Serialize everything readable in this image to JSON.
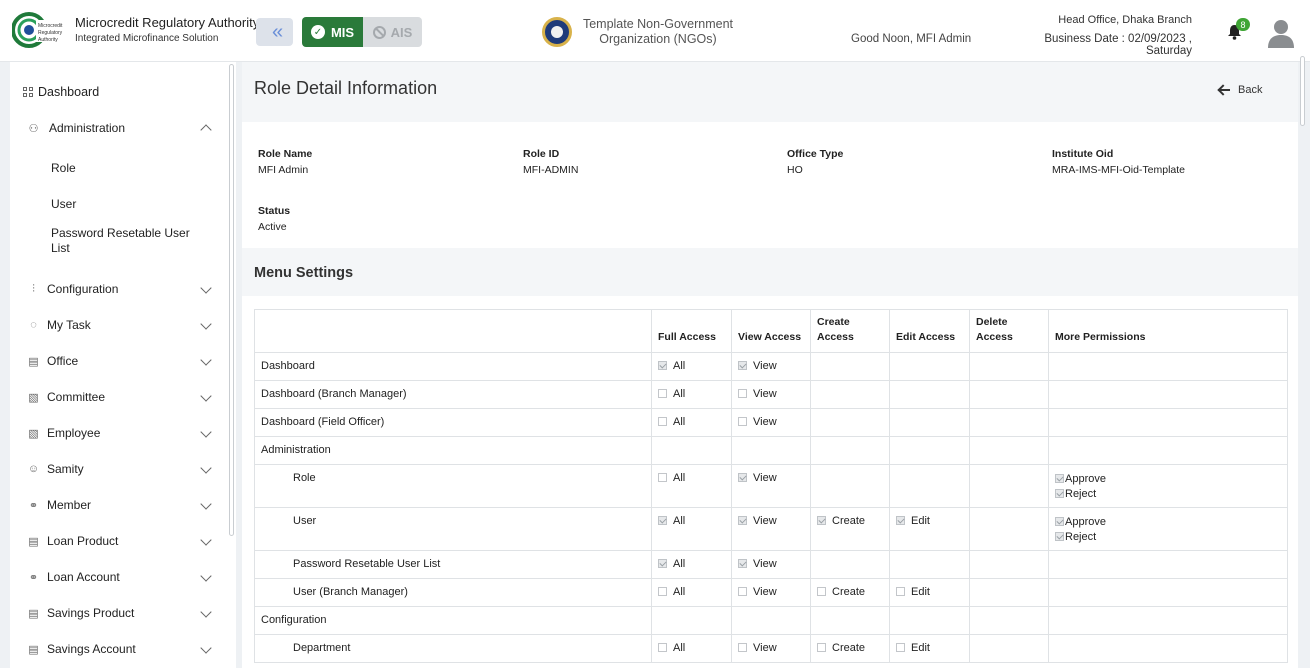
{
  "header": {
    "brand_title": "Microcredit Regulatory Authority",
    "brand_sub": "Integrated Microfinance Solution",
    "logo_text": "Microcredit Regulatory Authority",
    "mode_mis": "MIS",
    "mode_ais": "AIS",
    "org_name": "Template Non-Government Organization (NGOs)",
    "greeting": "Good Noon, MFI Admin",
    "branch": "Head Office, Dhaka Branch",
    "business_date": "Business Date : 02/09/2023 , Saturday",
    "notification_count": "8",
    "accent_color": "#2a7a3a"
  },
  "sidebar": {
    "dashboard": "Dashboard",
    "administration": "Administration",
    "admin_sub": [
      "Role",
      "User",
      "Password Resetable User List"
    ],
    "items": [
      "Configuration",
      "My Task",
      "Office",
      "Committee",
      "Employee",
      "Samity",
      "Member",
      "Loan Product",
      "Loan Account",
      "Savings Product",
      "Savings Account"
    ]
  },
  "page": {
    "title": "Role Detail Information",
    "back": "Back"
  },
  "info": {
    "role_name_label": "Role Name",
    "role_name": "MFI Admin",
    "role_id_label": "Role ID",
    "role_id": "MFI-ADMIN",
    "office_type_label": "Office Type",
    "office_type": "HO",
    "institute_oid_label": "Institute Oid",
    "institute_oid": "MRA-IMS-MFI-Oid-Template",
    "status_label": "Status",
    "status": "Active"
  },
  "menu_settings": {
    "title": "Menu Settings",
    "columns": [
      "",
      "Full Access",
      "View Access",
      "Create Access",
      "Edit Access",
      "Delete Access",
      "More Permissions"
    ],
    "labels": {
      "all": "All",
      "view": "View",
      "create": "Create",
      "edit": "Edit",
      "approve": "Approve",
      "reject": "Reject"
    },
    "rows": [
      {
        "name": "Dashboard",
        "indent": false,
        "all": true,
        "view": true
      },
      {
        "name": "Dashboard (Branch Manager)",
        "indent": false,
        "all": false,
        "view": false
      },
      {
        "name": "Dashboard (Field Officer)",
        "indent": false,
        "all": false,
        "view": false
      },
      {
        "name": "Administration",
        "indent": false,
        "group": true
      },
      {
        "name": "Role",
        "indent": true,
        "all": false,
        "view": true,
        "approve": true,
        "reject": true
      },
      {
        "name": "User",
        "indent": true,
        "all": true,
        "view": true,
        "create": true,
        "edit": true,
        "approve": true,
        "reject": true
      },
      {
        "name": "Password Resetable User List",
        "indent": true,
        "all": true,
        "view": true
      },
      {
        "name": "User (Branch Manager)",
        "indent": true,
        "all": false,
        "view": false,
        "create": false,
        "edit": false
      },
      {
        "name": "Configuration",
        "indent": false,
        "group": true
      },
      {
        "name": "Department",
        "indent": true,
        "all": false,
        "view": false,
        "create": false,
        "edit": false
      }
    ]
  }
}
